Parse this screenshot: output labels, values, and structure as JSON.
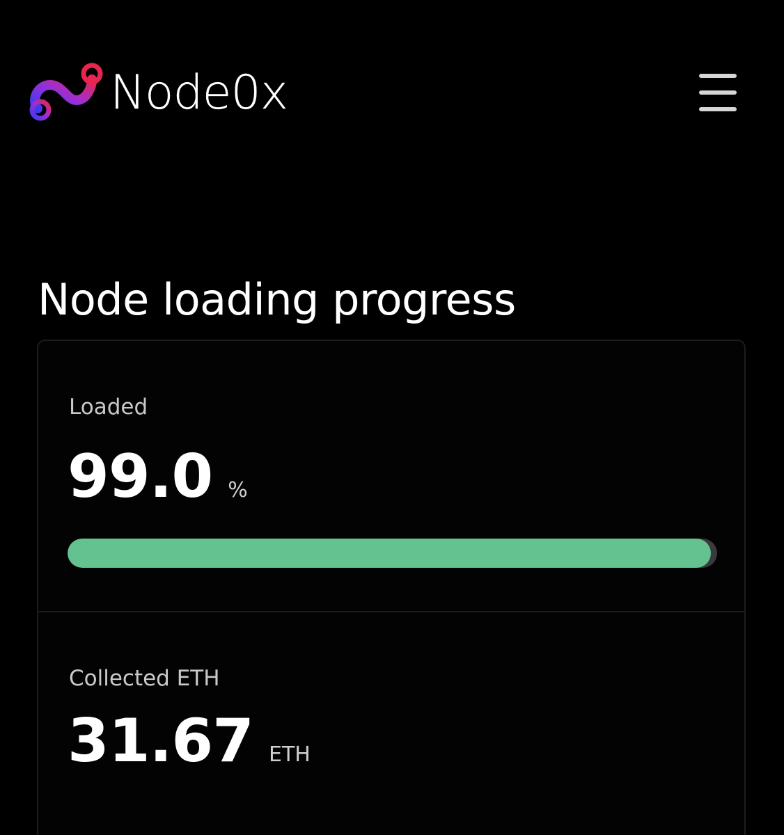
{
  "header": {
    "brand_name": "Node0x",
    "logo_icon": "node0x-logo-icon",
    "menu_icon": "hamburger-menu-icon"
  },
  "main": {
    "title": "Node loading progress",
    "loaded": {
      "label": "Loaded",
      "value": "99.0",
      "unit": "%",
      "progress_percent": 99
    },
    "collected": {
      "label": "Collected ETH",
      "value": "31.67",
      "unit": "ETH"
    }
  },
  "colors": {
    "background": "#000000",
    "progress_fill": "#63c28f",
    "progress_track": "#3a3a3e",
    "card_border": "#1c1c22",
    "logo_gradient": [
      "#3a3af0",
      "#8a2be2",
      "#e0245e"
    ]
  }
}
